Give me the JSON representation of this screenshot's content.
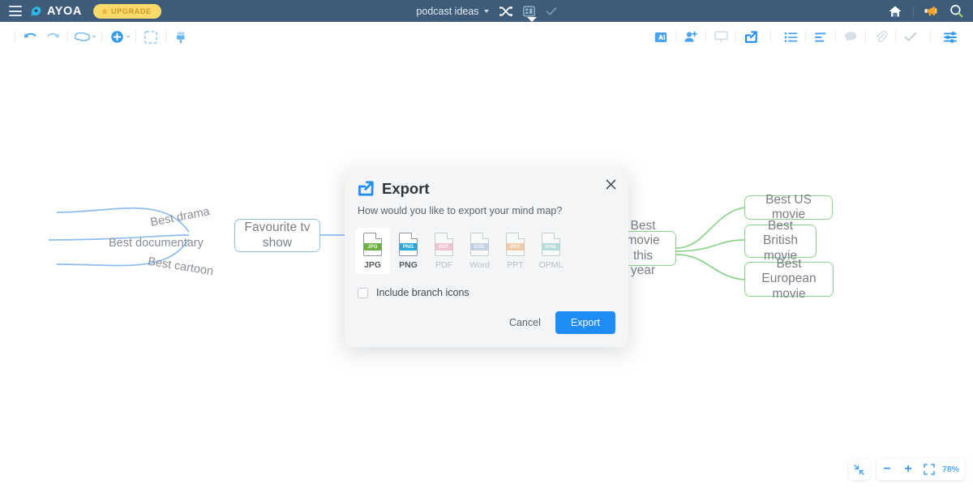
{
  "topbar": {
    "menu_icon": "hamburger-menu-icon",
    "brand": "AYOA",
    "upgrade_label": "UPGRADE",
    "doc_title": "podcast ideas",
    "center_icons": [
      "shuffle-icon",
      "board-view-icon",
      "check-icon"
    ],
    "right_icons": [
      "home-icon",
      "megaphone-icon",
      "search-icon"
    ]
  },
  "toolbar": {
    "left_icons": [
      "undo-icon",
      "redo-icon",
      "branch-shape-icon",
      "add-node-icon",
      "select-box-icon",
      "format-paint-icon"
    ],
    "right_icons": [
      "ai-assist-icon",
      "add-collaborator-icon",
      "presentation-icon",
      "export-icon",
      "list-view-icon",
      "align-icon",
      "comment-icon",
      "attachment-icon",
      "task-check-icon",
      "settings-sliders-icon"
    ]
  },
  "mindmap": {
    "nodes": [
      {
        "label": "Favourite tv\nshow",
        "color": "blue"
      },
      {
        "label": "Best movie this\nyear",
        "color": "green"
      },
      {
        "label": "Best US movie",
        "color": "green"
      },
      {
        "label": "Best British\nmovie",
        "color": "green"
      },
      {
        "label": "Best European\nmovie",
        "color": "green"
      }
    ],
    "branch_labels": [
      "Best drama",
      "Best documentary",
      "Best cartoon"
    ]
  },
  "dialog": {
    "icon": "export-icon",
    "title": "Export",
    "subtitle": "How would you like to export your mind map?",
    "close_icon": "close-icon",
    "formats": [
      {
        "label": "JPG",
        "badge": "JPG",
        "color": "#6cb33f",
        "selected": true,
        "disabled": false
      },
      {
        "label": "PNG",
        "badge": "PNG",
        "color": "#29a8e0",
        "selected": false,
        "disabled": false
      },
      {
        "label": "PDF",
        "badge": "PDF",
        "color": "#e87fa0",
        "selected": false,
        "disabled": true
      },
      {
        "label": "Word",
        "badge": "DOC",
        "color": "#7b9bc9",
        "selected": false,
        "disabled": true
      },
      {
        "label": "PPT",
        "badge": "PPT",
        "color": "#f0903c",
        "selected": false,
        "disabled": true
      },
      {
        "label": "OPML",
        "badge": "OPML",
        "color": "#5cb8b2",
        "selected": false,
        "disabled": true
      }
    ],
    "checkbox_label": "Include branch icons",
    "checkbox_checked": false,
    "cancel_label": "Cancel",
    "export_label": "Export"
  },
  "zoom": {
    "fit_icon": "collapse-fit-icon",
    "minus_label": "−",
    "plus_label": "+",
    "fullscreen_icon": "fit-screen-icon",
    "percent": "78%"
  },
  "colors": {
    "topbar_bg": "#3e5c79",
    "accent_blue": "#1f8df5",
    "upgrade_yellow": "#f8d96a",
    "node_blue": "#8fbdf0",
    "node_green": "#8cd48c"
  }
}
